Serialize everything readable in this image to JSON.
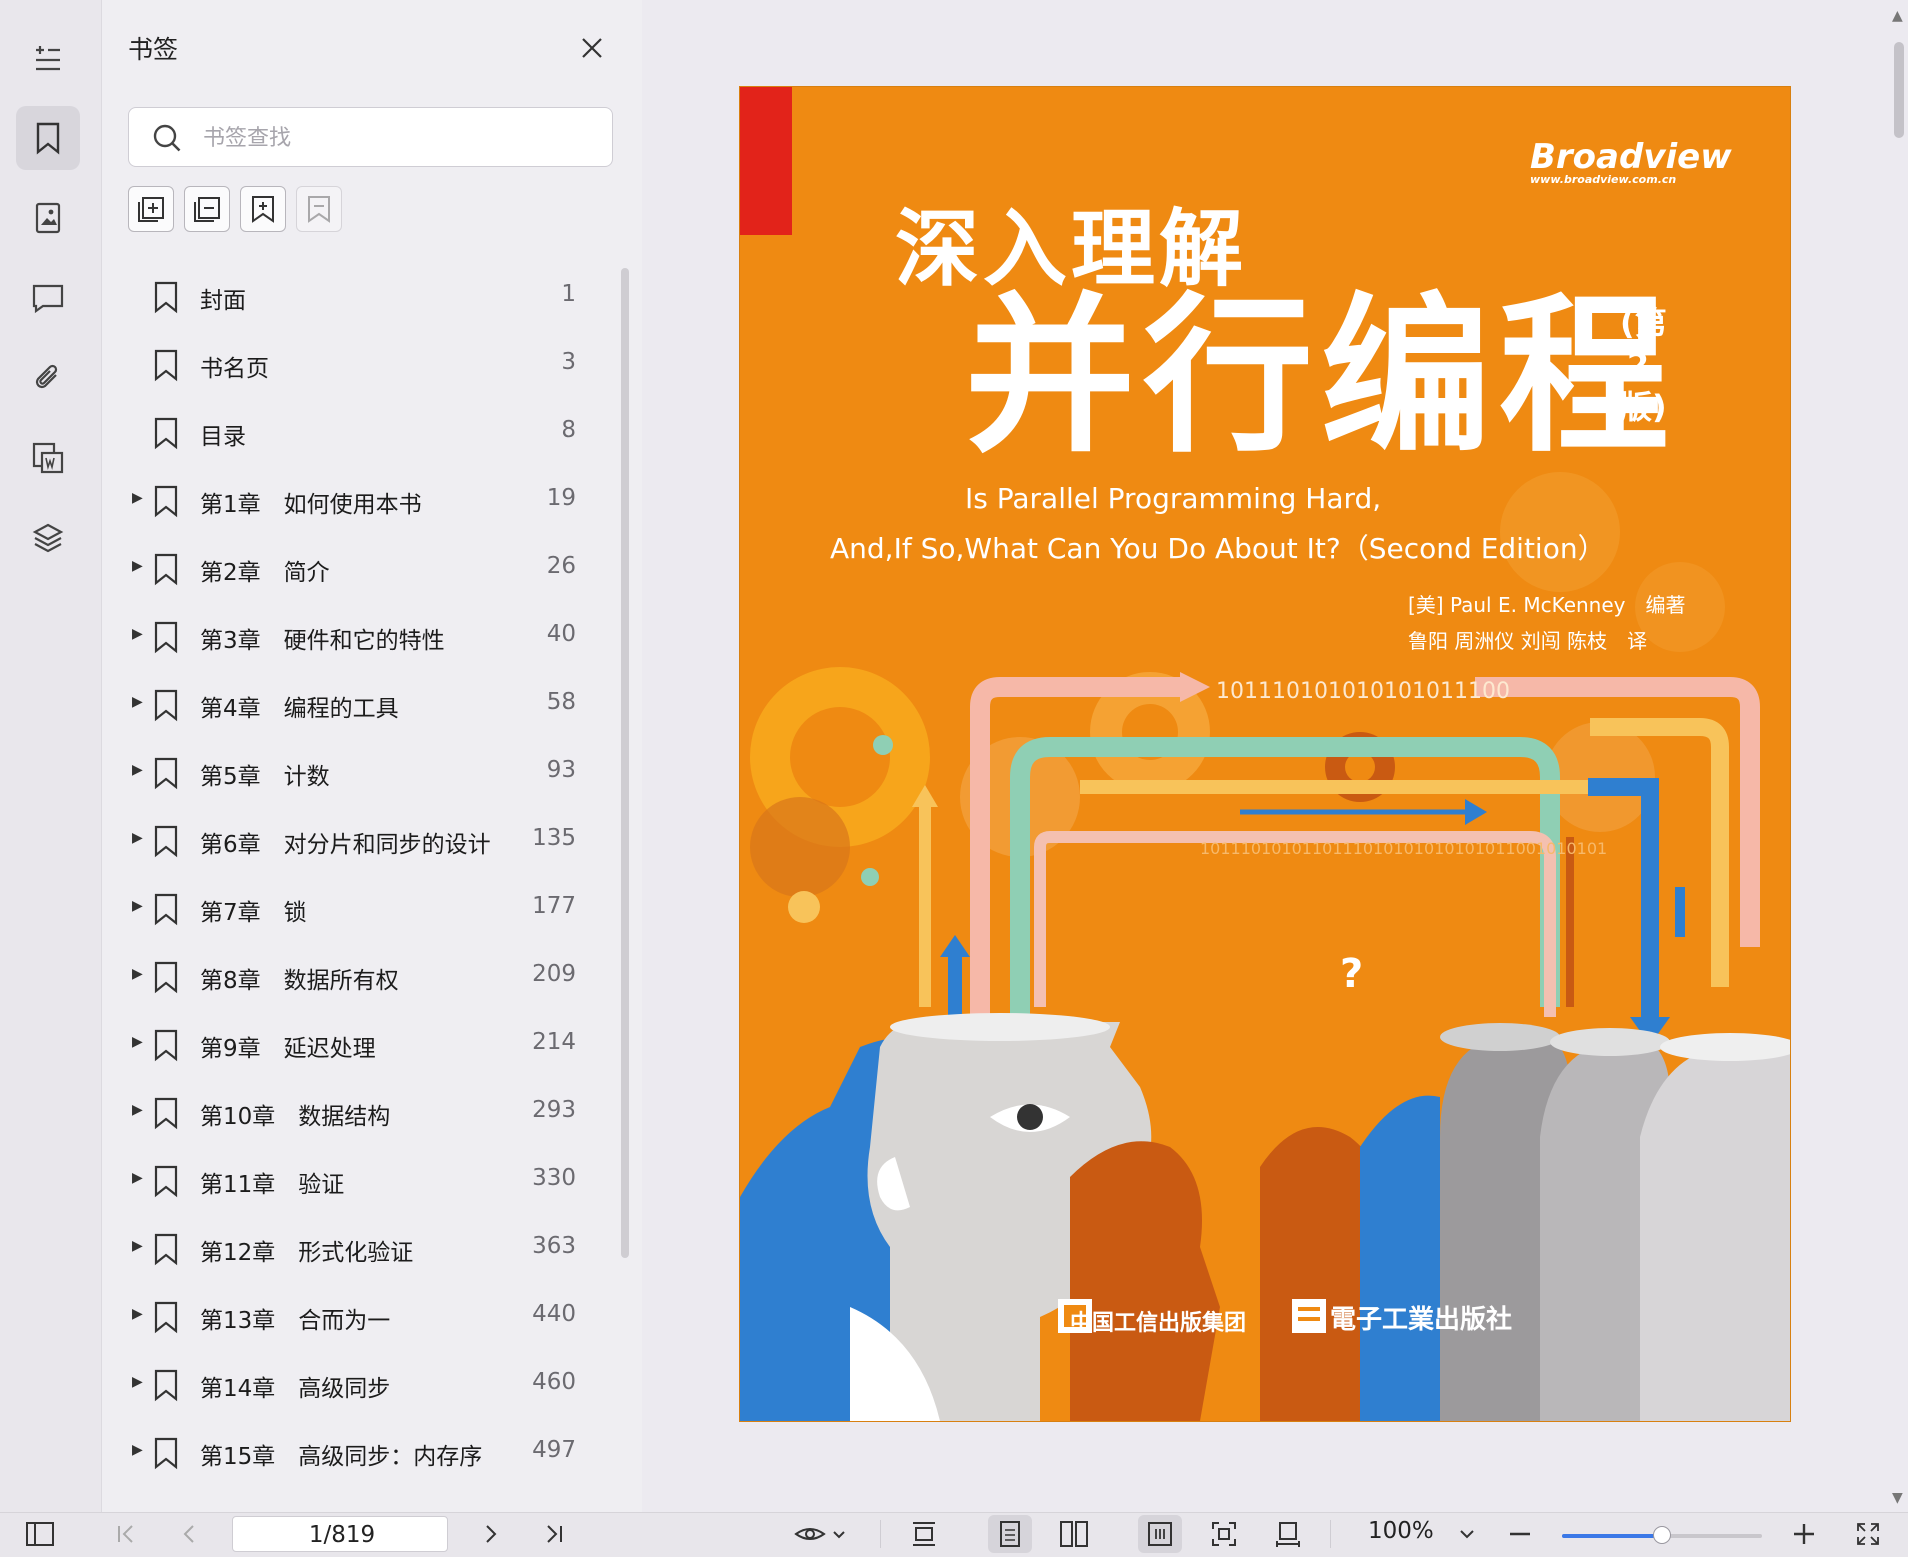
{
  "panel": {
    "title": "书签",
    "search_placeholder": "书签查找"
  },
  "bookmarks": [
    {
      "label": "封面",
      "page": "1",
      "expandable": false
    },
    {
      "label": "书名页",
      "page": "3",
      "expandable": false
    },
    {
      "label": "目录",
      "page": "8",
      "expandable": false
    },
    {
      "label": "第1章　如何使用本书",
      "page": "19",
      "expandable": true
    },
    {
      "label": "第2章　简介",
      "page": "26",
      "expandable": true
    },
    {
      "label": "第3章　硬件和它的特性",
      "page": "40",
      "expandable": true
    },
    {
      "label": "第4章　编程的工具",
      "page": "58",
      "expandable": true
    },
    {
      "label": "第5章　计数",
      "page": "93",
      "expandable": true
    },
    {
      "label": "第6章　对分片和同步的设计",
      "page": "135",
      "expandable": true
    },
    {
      "label": "第7章　锁",
      "page": "177",
      "expandable": true
    },
    {
      "label": "第8章　数据所有权",
      "page": "209",
      "expandable": true
    },
    {
      "label": "第9章　延迟处理",
      "page": "214",
      "expandable": true
    },
    {
      "label": "第10章　数据结构",
      "page": "293",
      "expandable": true
    },
    {
      "label": "第11章　验证",
      "page": "330",
      "expandable": true
    },
    {
      "label": "第12章　形式化验证",
      "page": "363",
      "expandable": true
    },
    {
      "label": "第13章　合而为一",
      "page": "440",
      "expandable": true
    },
    {
      "label": "第14章　高级同步",
      "page": "460",
      "expandable": true
    },
    {
      "label": "第15章　高级同步：内存序",
      "page": "497",
      "expandable": true
    }
  ],
  "cover": {
    "brand": "Broadview",
    "brand_url": "www.broadview.com.cn",
    "title_line1": "深入理解",
    "title_line2": "并行编程",
    "edition": "(第2版)",
    "subtitle_line1": "Is Parallel Programming Hard,",
    "subtitle_line2": "And,If So,What Can You Do About It?（Second Edition）",
    "author_line": "[美] Paul E. McKenney　编著",
    "translators_line": "鲁阳 周洲仪 刘闯 陈枝　译",
    "binary_1": "101110101010101011100",
    "binary_2": "1011101010110111010101010101011001010101",
    "publisher_1": "中国工信出版集团",
    "publisher_2": "電子工業出版社"
  },
  "status": {
    "page_indicator": "1/819",
    "zoom": "100%",
    "zoom_fraction": 0.5
  },
  "colors": {
    "cover_orange": "#ef8a12",
    "cover_red": "#e2231a",
    "accent_blue": "#3b78e7"
  }
}
